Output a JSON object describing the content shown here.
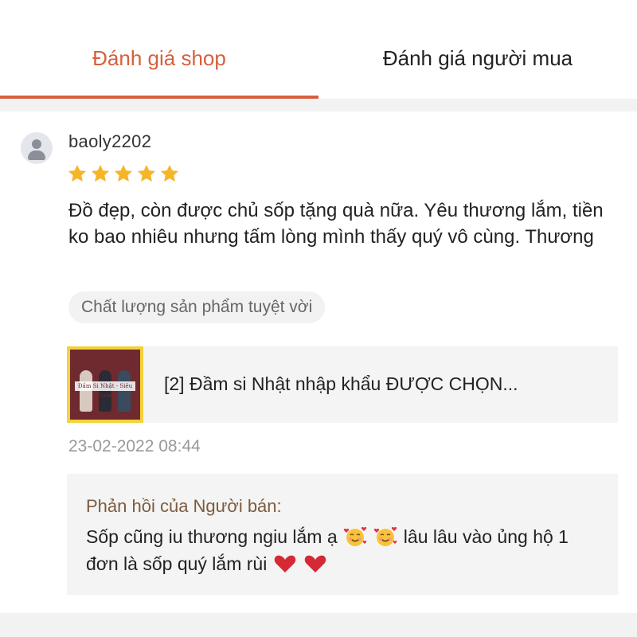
{
  "tabs": [
    {
      "label": "Đánh giá shop",
      "active": true
    },
    {
      "label": "Đánh giá người mua",
      "active": false
    }
  ],
  "review": {
    "username": "baoly2202",
    "rating": 5,
    "max_rating": 5,
    "text": "Đồ đẹp, còn được chủ sốp tặng quà nữa. Yêu thương lắm, tiền ko bao nhiêu nhưng tấm lòng mình thấy quý vô cùng. Thương",
    "tag": "Chất lượng sản phẩm tuyệt vời",
    "product": {
      "name": "[2] Đầm si Nhật nhập khẩu ĐƯỢC CHỌN...",
      "thumb_caption": "Đầm Si Nhật - Siêu Sale"
    },
    "timestamp": "23-02-2022 08:44",
    "seller_reply": {
      "title": "Phản hồi của Người bán:",
      "text_part1": "Sốp cũng iu thương ngiu lắm ạ",
      "text_part2": "lâu lâu vào ủng hộ 1 đơn là sốp quý lắm rùi"
    }
  },
  "colors": {
    "accent": "#d65f3c",
    "star": "#f6b529",
    "reply_title": "#7d5b3e",
    "muted": "#999999"
  },
  "icons": [
    "user-avatar-icon",
    "star-icon",
    "smiling-hearts-emoji",
    "red-heart-emoji"
  ]
}
